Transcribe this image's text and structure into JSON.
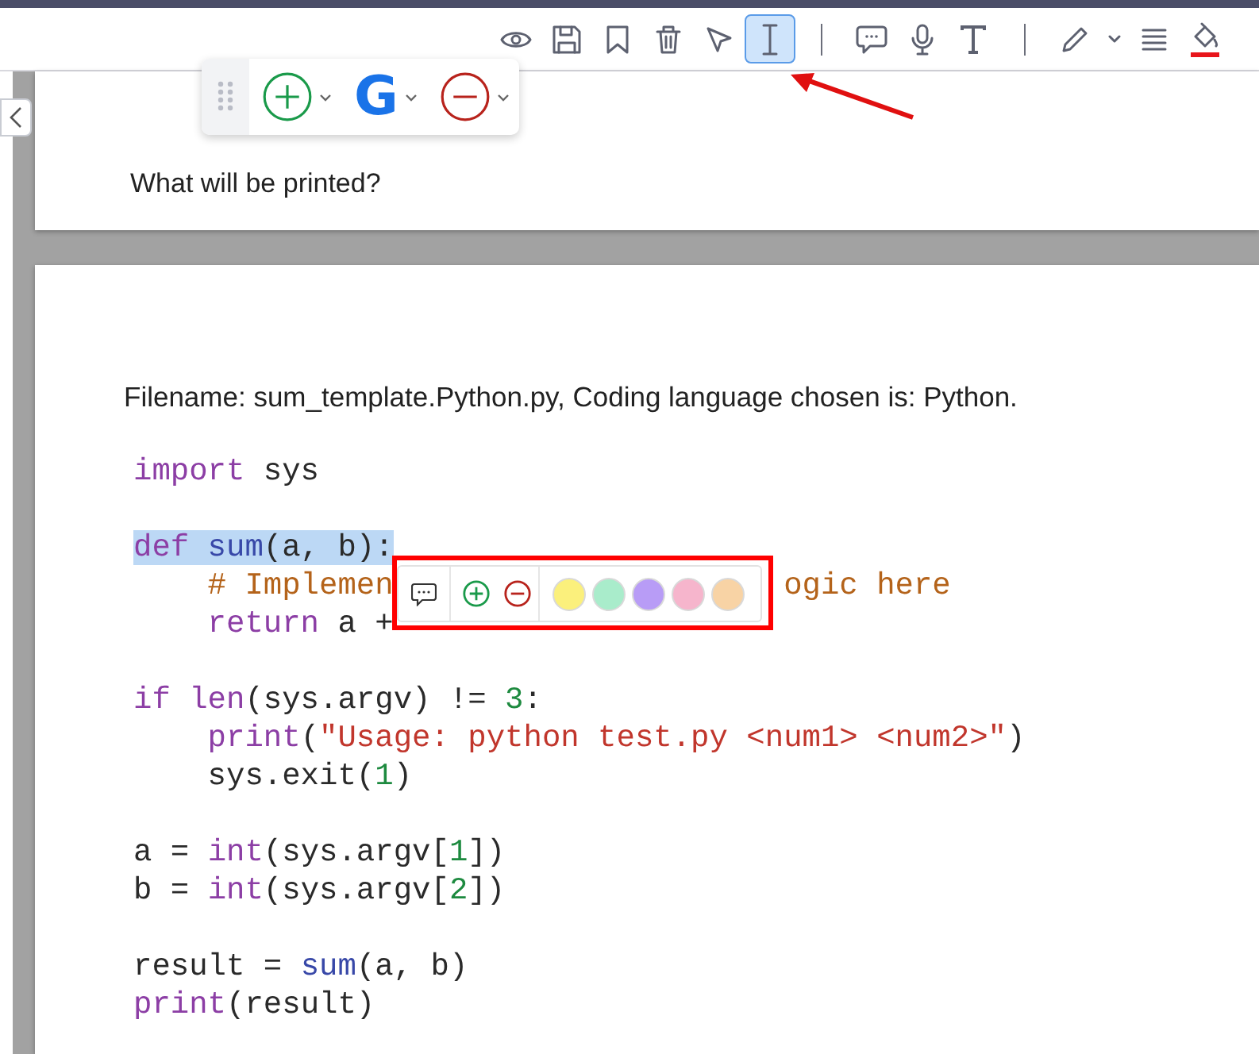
{
  "toolbar": {
    "items": [
      {
        "kind": "view",
        "selected": false
      },
      {
        "kind": "save",
        "selected": false
      },
      {
        "kind": "bookmark",
        "selected": false
      },
      {
        "kind": "delete",
        "selected": false
      },
      {
        "kind": "select",
        "selected": false
      },
      {
        "kind": "textselect",
        "selected": true
      },
      {
        "kind": "divider"
      },
      {
        "kind": "comment",
        "selected": false
      },
      {
        "kind": "voice",
        "selected": false
      },
      {
        "kind": "text",
        "selected": false
      },
      {
        "kind": "divider"
      },
      {
        "kind": "draw",
        "selected": false
      },
      {
        "kind": "drawmenu",
        "selected": false
      },
      {
        "kind": "align",
        "selected": false
      },
      {
        "kind": "fill",
        "selected": false,
        "color": "#e8151b"
      }
    ]
  },
  "floating_toolbar": {
    "items": [
      {
        "kind": "add"
      },
      {
        "kind": "google",
        "label": "G"
      },
      {
        "kind": "remove"
      }
    ]
  },
  "pages": [
    {
      "question": "What will be printed?"
    },
    {
      "filename_line": "Filename: sum_template.Python.py, Coding language chosen is: Python.",
      "code_lines": [
        {
          "tokens": [
            {
              "kind": "keyword",
              "text": "import"
            },
            {
              "kind": "plain",
              "text": "sys",
              "space_before": true
            }
          ]
        },
        {
          "gap_before": true,
          "highlighted": true,
          "tokens": [
            {
              "kind": "keyword",
              "text": "def"
            },
            {
              "kind": "function",
              "text": "sum",
              "space_before": true
            },
            {
              "kind": "plain",
              "text": "(a, b):"
            }
          ]
        },
        {
          "indented": true,
          "tokens": [
            {
              "kind": "comment",
              "text": "# Implemen"
            },
            {
              "kind": "comment",
              "text": "ogic here",
              "covered_before": true
            }
          ]
        },
        {
          "indented": true,
          "tokens": [
            {
              "kind": "keyword",
              "text": "return"
            },
            {
              "kind": "plain",
              "text": "a +",
              "space_before": true
            }
          ]
        },
        {
          "gap_before": true,
          "tokens": [
            {
              "kind": "keyword",
              "text": "if"
            },
            {
              "kind": "keyword",
              "text": "len",
              "space_before": true
            },
            {
              "kind": "plain",
              "text": "(sys.argv) != "
            },
            {
              "kind": "number",
              "text": "3"
            },
            {
              "kind": "plain",
              "text": ":"
            }
          ]
        },
        {
          "indented": true,
          "tokens": [
            {
              "kind": "keyword",
              "text": "print"
            },
            {
              "kind": "plain",
              "text": "("
            },
            {
              "kind": "string",
              "text": "\"Usage: python test.py <num1> <num2>\""
            },
            {
              "kind": "plain",
              "text": ")"
            }
          ]
        },
        {
          "indented": true,
          "tokens": [
            {
              "kind": "plain",
              "text": "sys.exit("
            },
            {
              "kind": "number",
              "text": "1"
            },
            {
              "kind": "plain",
              "text": ")"
            }
          ]
        },
        {
          "gap_before": true,
          "tokens": [
            {
              "kind": "plain",
              "text": "a = "
            },
            {
              "kind": "keyword",
              "text": "int"
            },
            {
              "kind": "plain",
              "text": "(sys.argv["
            },
            {
              "kind": "number",
              "text": "1"
            },
            {
              "kind": "plain",
              "text": "])"
            }
          ]
        },
        {
          "tokens": [
            {
              "kind": "plain",
              "text": "b = "
            },
            {
              "kind": "keyword",
              "text": "int"
            },
            {
              "kind": "plain",
              "text": "(sys.argv["
            },
            {
              "kind": "number",
              "text": "2"
            },
            {
              "kind": "plain",
              "text": "])"
            }
          ]
        },
        {
          "gap_before": true,
          "tokens": [
            {
              "kind": "plain",
              "text": "result = "
            },
            {
              "kind": "function",
              "text": "sum"
            },
            {
              "kind": "plain",
              "text": "(a, b)"
            }
          ]
        },
        {
          "tokens": [
            {
              "kind": "keyword",
              "text": "print"
            },
            {
              "kind": "plain",
              "text": "(result)"
            }
          ]
        }
      ]
    }
  ],
  "selection_popup": {
    "tools": [
      {
        "kind": "comment"
      },
      {
        "kind": "add"
      },
      {
        "kind": "remove"
      }
    ],
    "colors": [
      {
        "color": "#fbf07c"
      },
      {
        "color": "#a9eccb"
      },
      {
        "color": "#b89cf6"
      },
      {
        "color": "#f6b5cc"
      },
      {
        "color": "#f8d3a5"
      }
    ]
  }
}
